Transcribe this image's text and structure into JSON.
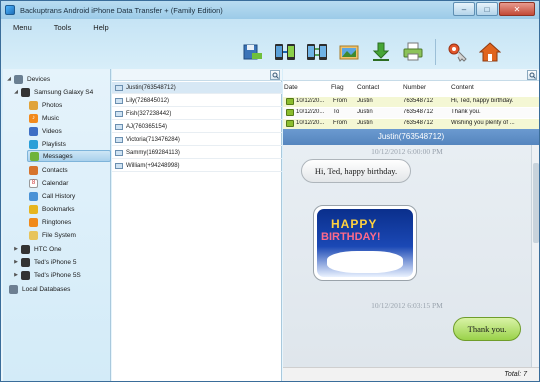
{
  "window": {
    "title": "Backuptrans Android iPhone Data Transfer + (Family Edition)",
    "minimize": "–",
    "maximize": "□",
    "close": "✕"
  },
  "menu": [
    "Menu",
    "Tools",
    "Help"
  ],
  "toolbar": [
    {
      "icon": "save-database-icon"
    },
    {
      "icon": "phone-transfer-icon"
    },
    {
      "icon": "phone-sync-icon"
    },
    {
      "icon": "picture-export-icon"
    },
    {
      "icon": "download-icon"
    },
    {
      "icon": "printer-icon"
    },
    {
      "icon": "key-icon"
    },
    {
      "icon": "home-icon"
    }
  ],
  "tree": {
    "root": "Devices",
    "device": "Samsung Galaxy S4",
    "items": [
      "Photos",
      "Music",
      "Videos",
      "Playlists",
      "Messages",
      "Contacts",
      "Calendar",
      "Call History",
      "Bookmarks",
      "Ringtones",
      "File System"
    ],
    "other_devices": [
      "HTC One",
      "Ted's iPhone 5",
      "Ted's iPhone 5S"
    ],
    "local": "Local Databases"
  },
  "contacts": [
    "Justin(763548712)",
    "Lily(726845012)",
    "Fish(327238442)",
    "AJ(760365154)",
    "Victoria(713476284)",
    "Sammy(169284113)",
    "William(+94248998)"
  ],
  "messages": {
    "headers": [
      "Date",
      "Flag",
      "Contact",
      "Number",
      "Content"
    ],
    "rows": [
      {
        "date": "10/12/20...",
        "flag": "From",
        "contact": "Justin",
        "number": "763548712",
        "content": "Hi, Ted, happy birthday."
      },
      {
        "date": "10/12/20...",
        "flag": "To",
        "contact": "Justin",
        "number": "763548712",
        "content": "Thank you."
      },
      {
        "date": "10/12/20...",
        "flag": "From",
        "contact": "Justin",
        "number": "763548712",
        "content": "Wishing you plenty of ..."
      }
    ]
  },
  "conversation": {
    "title": "Justin(763548712)",
    "ts1": "10/12/2012 6:00:00 PM",
    "bubble1": "Hi, Ted, happy birthday.",
    "card_happy": "HAPPY",
    "card_birthday": "BIRTHDAY!",
    "ts2": "10/12/2012 6:03:15 PM",
    "bubble2": "Thank you."
  },
  "footer": {
    "total": "Total: 7"
  }
}
